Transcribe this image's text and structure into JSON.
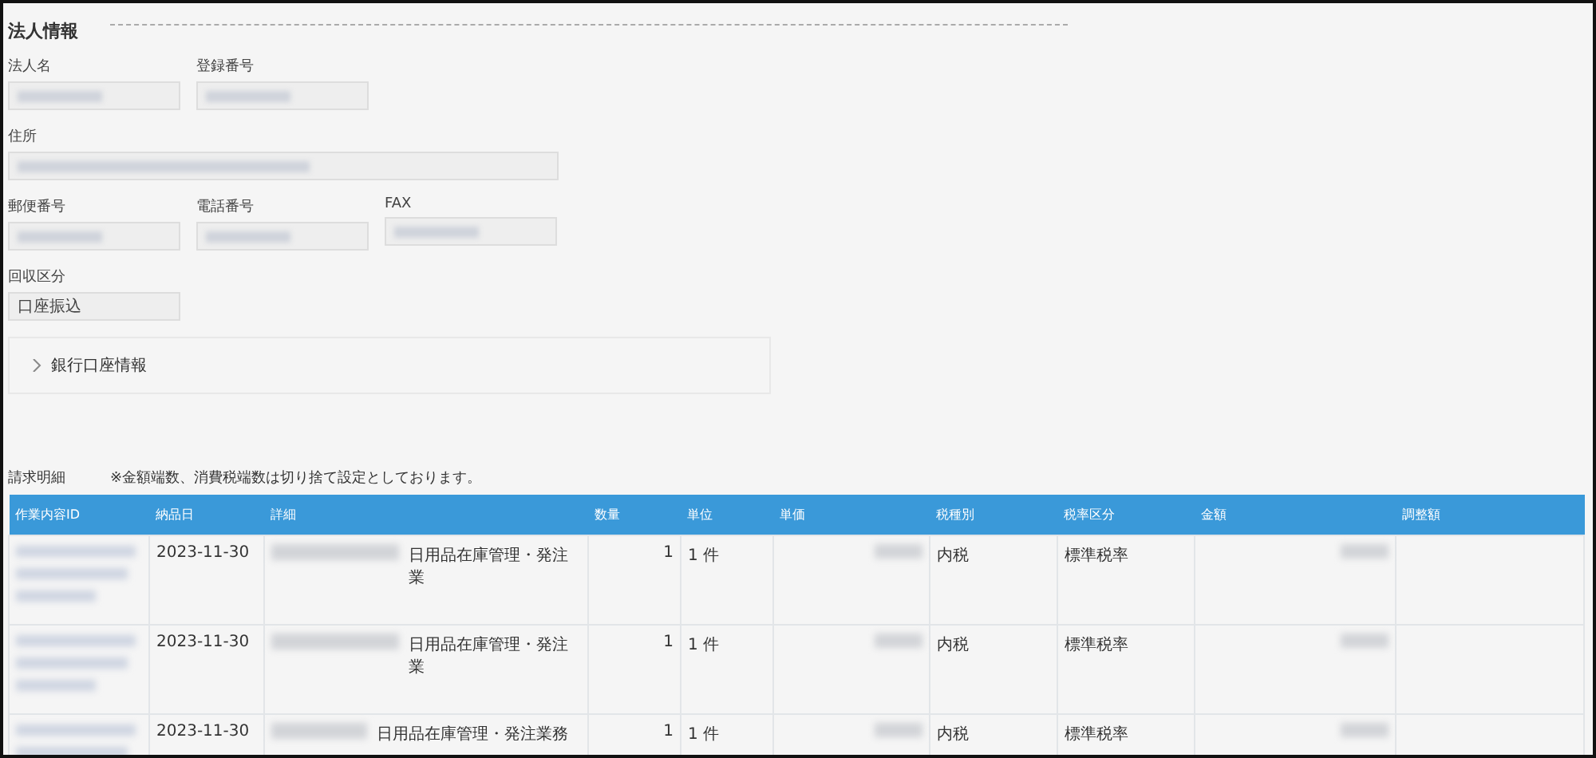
{
  "section": {
    "title": "法人情報"
  },
  "field_rows": [
    {
      "fields": [
        {
          "label": "法人名"
        },
        {
          "label": "登録番号"
        }
      ]
    },
    {
      "fields": [
        {
          "label": "住所"
        }
      ]
    },
    {
      "fields": [
        {
          "label": "郵便番号"
        },
        {
          "label": "電話番号"
        },
        {
          "label": "FAX"
        }
      ]
    },
    {
      "fields": [
        {
          "label": "回収区分",
          "value": "口座振込"
        }
      ]
    }
  ],
  "bank": {
    "label": "銀行口座情報",
    "expanded": false
  },
  "invoice": {
    "title": "請求明細",
    "note": "※金額端数、消費税端数は切り捨て設定としております。",
    "columns": [
      "作業内容ID",
      "納品日",
      "詳細",
      "数量",
      "単位",
      "単価",
      "税種別",
      "税率区分",
      "金額",
      "調整額"
    ],
    "rows": [
      {
        "date": "2023-11-30",
        "detail": "日用品在庫管理・発注業",
        "quantity": "1",
        "unit": "1 件",
        "tax_type": "内税",
        "tax_rate": "標準税率"
      },
      {
        "date": "2023-11-30",
        "detail": "日用品在庫管理・発注業",
        "quantity": "1",
        "unit": "1 件",
        "tax_type": "内税",
        "tax_rate": "標準税率"
      },
      {
        "date": "2023-11-30",
        "detail": "日用品在庫管理・発注業務",
        "quantity": "1",
        "unit": "1 件",
        "tax_type": "内税",
        "tax_rate": "標準税率"
      }
    ]
  }
}
